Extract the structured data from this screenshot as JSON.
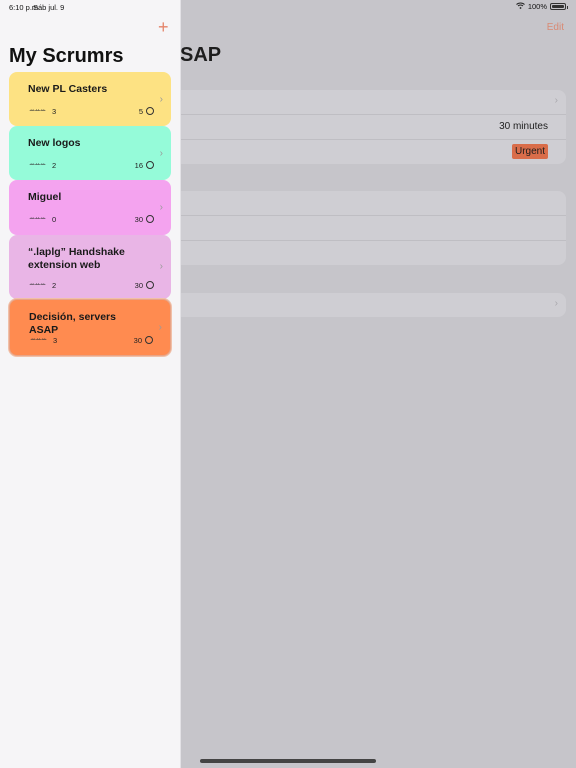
{
  "status_bar": {
    "time": "6:10 p.m.",
    "date": "Sáb jul. 9",
    "battery": "100%"
  },
  "sidebar": {
    "title": "My Scrumrs",
    "add_label": "+",
    "scrums": [
      {
        "name": "New PL Casters",
        "attendees": "3",
        "duration": "5",
        "color": "#fde283"
      },
      {
        "name": "New logos",
        "attendees": "2",
        "duration": "16",
        "color": "#95fbd9"
      },
      {
        "name": "Miguel",
        "attendees": "0",
        "duration": "30",
        "color": "#f4a3ef"
      },
      {
        "name": "“.laplg” Handshake extension web",
        "attendees": "2",
        "duration": "30",
        "color": "#e9b5e6"
      },
      {
        "name": "Decisión, servers ASAP",
        "attendees": "3",
        "duration": "30",
        "color": "#ff8b50"
      }
    ]
  },
  "detail": {
    "edit_label": "Edit",
    "title_visible": "SAP",
    "length_value": "30 minutes",
    "theme_value": "Urgent",
    "chevron": "›"
  }
}
